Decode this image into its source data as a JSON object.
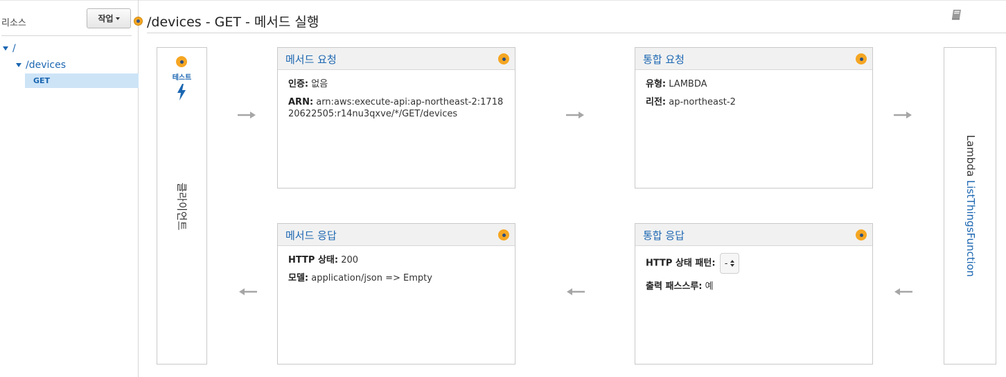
{
  "sidebar": {
    "title": "리소스",
    "action_label": "작업",
    "tree": {
      "root_label": "/",
      "child_label": "/devices",
      "method_label": "GET"
    }
  },
  "header": {
    "title": "/devices - GET - 메서드 실행",
    "icon": "book-icon"
  },
  "client": {
    "test_label": "테스트",
    "label": "클라이언트",
    "icon": "lightning-bolt-icon"
  },
  "method_request": {
    "title": "메서드 요청",
    "auth_key": "인증:",
    "auth_value": "없음",
    "arn_key": "ARN:",
    "arn_value": "arn:aws:execute-api:ap-northeast-2:171820622505:r14nu3qxve/*/GET/devices"
  },
  "integration_request": {
    "title": "통합 요청",
    "type_key": "유형:",
    "type_value": "LAMBDA",
    "region_key": "리전:",
    "region_value": "ap-northeast-2"
  },
  "method_response": {
    "title": "메서드 응답",
    "status_key": "HTTP 상태:",
    "status_value": "200",
    "model_key": "모델:",
    "model_value": "application/json => Empty"
  },
  "integration_response": {
    "title": "통합 응답",
    "pattern_key": "HTTP 상태 패턴:",
    "pattern_value": "-",
    "passthrough_key": "출력 패스스루:",
    "passthrough_value": "예"
  },
  "lambda": {
    "prefix": "Lambda",
    "function_name": "ListThingsFunction"
  },
  "colors": {
    "accent_orange": "#f5a623",
    "link_blue": "#1b66b1",
    "arrow_gray": "#a6a6a6"
  }
}
